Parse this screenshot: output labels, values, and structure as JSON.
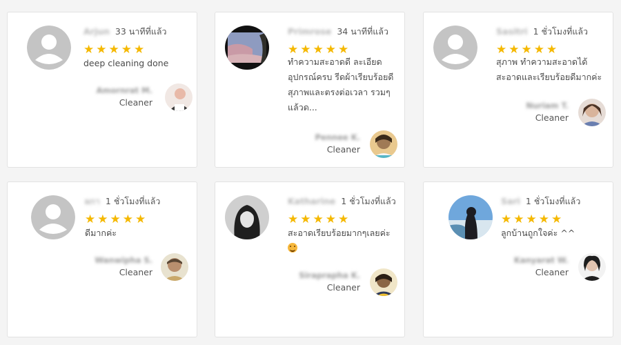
{
  "reviews": [
    {
      "reviewer_name": "Arjun",
      "time_ago": "33 นาทีที่แล้ว",
      "rating": 5,
      "text_lines": [
        "deep cleaning done"
      ],
      "cleaner_name": "Amornrat M.",
      "cleaner_role": "Cleaner"
    },
    {
      "reviewer_name": "Primrose",
      "time_ago": "34 นาทีที่แล้ว",
      "rating": 5,
      "text_lines": [
        "ทำความสะอาดดี ละเอียด",
        "อุปกรณ์ครบ รีดผ้าเรียบร้อยดี",
        "สุภาพและตรงต่อเวลา รวมๆ",
        "แล้วด..."
      ],
      "cleaner_name": "Pennee K.",
      "cleaner_role": "Cleaner"
    },
    {
      "reviewer_name": "Sasitri",
      "time_ago": "1 ชั่วโมงที่แล้ว",
      "rating": 5,
      "text_lines": [
        "สุภาพ ทำความสะอาดได้",
        "สะอาดและเรียบร้อยดีมากค่ะ"
      ],
      "cleaner_name": "Nuriam T.",
      "cleaner_role": "Cleaner"
    },
    {
      "reviewer_name": "ผกา",
      "time_ago": "1 ชั่วโมงที่แล้ว",
      "rating": 5,
      "text_lines": [
        "ดีมากค่ะ"
      ],
      "cleaner_name": "Wanwipha S.",
      "cleaner_role": "Cleaner"
    },
    {
      "reviewer_name": "Katharine",
      "time_ago": "1 ชั่วโมงที่แล้ว",
      "rating": 5,
      "text_lines": [
        "สะอาดเรียบร้อยมากๆเลยค่ะ"
      ],
      "has_emoji": true,
      "cleaner_name": "Siraprapha K.",
      "cleaner_role": "Cleaner"
    },
    {
      "reviewer_name": "Sari",
      "time_ago": "1 ชั่วโมงที่แล้ว",
      "rating": 5,
      "text_lines": [
        "ลูกบ้านถูกใจค่ะ ^^"
      ],
      "cleaner_name": "Kanyarat W.",
      "cleaner_role": "Cleaner"
    }
  ],
  "icons": {
    "star": "star-icon",
    "default_avatar": "user-placeholder-icon",
    "emoji": "smiling-face-emoji"
  },
  "colors": {
    "star": "#f5b800",
    "background": "#f4f4f4",
    "card": "#ffffff",
    "placeholder_avatar": "#c4c4c4"
  }
}
